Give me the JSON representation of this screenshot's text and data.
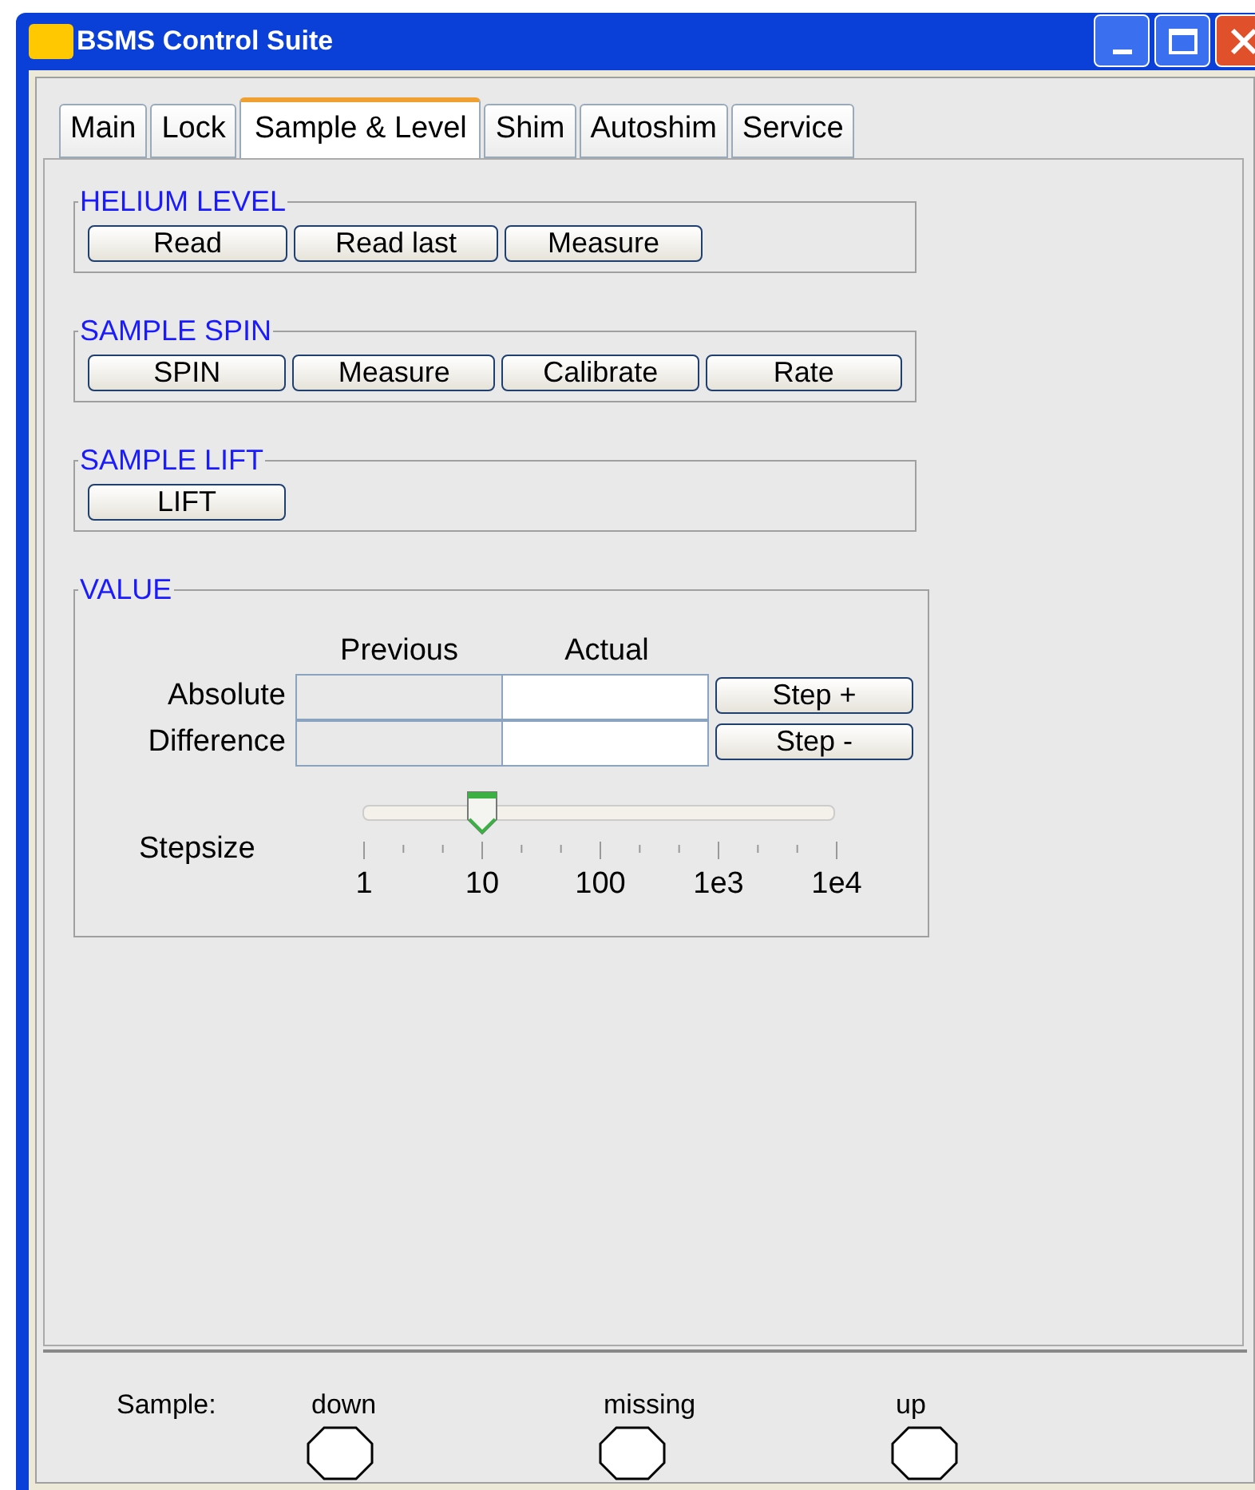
{
  "window": {
    "title": "BSMS Control Suite"
  },
  "tabs": [
    {
      "label": "Main",
      "selected": false
    },
    {
      "label": "Lock",
      "selected": false
    },
    {
      "label": "Sample & Level",
      "selected": true
    },
    {
      "label": "Shim",
      "selected": false
    },
    {
      "label": "Autoshim",
      "selected": false
    },
    {
      "label": "Service",
      "selected": false
    }
  ],
  "groups": [
    {
      "title": "HELIUM LEVEL",
      "buttons": [
        "Read",
        "Read last",
        "Measure"
      ]
    },
    {
      "title": "SAMPLE SPIN",
      "buttons": [
        "SPIN",
        "Measure",
        "Calibrate",
        "Rate"
      ]
    },
    {
      "title": "SAMPLE LIFT",
      "buttons": [
        "LIFT"
      ]
    }
  ],
  "value": {
    "title": "VALUE",
    "columns": [
      "Previous",
      "Actual"
    ],
    "rows": [
      {
        "label": "Absolute",
        "button": "Step +"
      },
      {
        "label": "Difference",
        "button": "Step -"
      }
    ],
    "stepsize": {
      "label": "Stepsize",
      "level": 0.25,
      "ticks": [
        "1",
        "10",
        "100",
        "1e3",
        "1e4"
      ]
    }
  },
  "status": {
    "label": "Sample:",
    "indicators": [
      {
        "label": "down",
        "lit": false
      },
      {
        "label": "missing",
        "lit": false
      },
      {
        "label": "up",
        "lit": false
      }
    ]
  }
}
